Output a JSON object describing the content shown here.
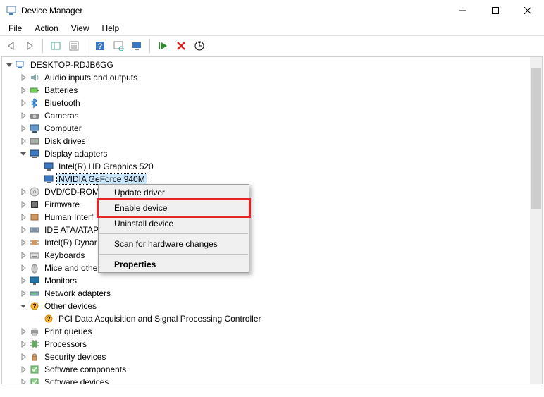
{
  "window": {
    "title": "Device Manager"
  },
  "menubar": [
    "File",
    "Action",
    "View",
    "Help"
  ],
  "tree": {
    "root": "DESKTOP-RDJB6GG",
    "categories": [
      {
        "label": "Audio inputs and outputs",
        "expanded": false,
        "icon": "audio"
      },
      {
        "label": "Batteries",
        "expanded": false,
        "icon": "battery"
      },
      {
        "label": "Bluetooth",
        "expanded": false,
        "icon": "bluetooth"
      },
      {
        "label": "Cameras",
        "expanded": false,
        "icon": "camera"
      },
      {
        "label": "Computer",
        "expanded": false,
        "icon": "computer"
      },
      {
        "label": "Disk drives",
        "expanded": false,
        "icon": "disk"
      },
      {
        "label": "Display adapters",
        "expanded": true,
        "icon": "display",
        "children": [
          {
            "label": "Intel(R) HD Graphics 520",
            "icon": "display"
          },
          {
            "label": "NVIDIA GeForce 940M",
            "icon": "display",
            "selected": true
          }
        ]
      },
      {
        "label": "DVD/CD-ROM",
        "expanded": false,
        "icon": "dvd",
        "truncated": true
      },
      {
        "label": "Firmware",
        "expanded": false,
        "icon": "firmware"
      },
      {
        "label": "Human Interf",
        "expanded": false,
        "icon": "hid",
        "truncated": true
      },
      {
        "label": "IDE ATA/ATAP",
        "expanded": false,
        "icon": "ide",
        "truncated": true
      },
      {
        "label": "Intel(R) Dynar",
        "expanded": false,
        "icon": "chip",
        "truncated": true
      },
      {
        "label": "Keyboards",
        "expanded": false,
        "icon": "keyboard"
      },
      {
        "label": "Mice and othe",
        "expanded": false,
        "icon": "mouse",
        "truncated": true
      },
      {
        "label": "Monitors",
        "expanded": false,
        "icon": "monitor"
      },
      {
        "label": "Network adapters",
        "expanded": false,
        "icon": "network"
      },
      {
        "label": "Other devices",
        "expanded": true,
        "icon": "other",
        "children": [
          {
            "label": "PCI Data Acquisition and Signal Processing Controller",
            "icon": "warn"
          }
        ]
      },
      {
        "label": "Print queues",
        "expanded": false,
        "icon": "printer"
      },
      {
        "label": "Processors",
        "expanded": false,
        "icon": "cpu"
      },
      {
        "label": "Security devices",
        "expanded": false,
        "icon": "security"
      },
      {
        "label": "Software components",
        "expanded": false,
        "icon": "software"
      },
      {
        "label": "Software devices",
        "expanded": false,
        "icon": "software"
      }
    ]
  },
  "context_menu": {
    "items": [
      {
        "label": "Update driver",
        "sep_after": false
      },
      {
        "label": "Enable device",
        "highlighted": true
      },
      {
        "label": "Uninstall device",
        "sep_after": true
      },
      {
        "label": "Scan for hardware changes",
        "sep_after": true
      },
      {
        "label": "Properties",
        "bold": true
      }
    ]
  }
}
